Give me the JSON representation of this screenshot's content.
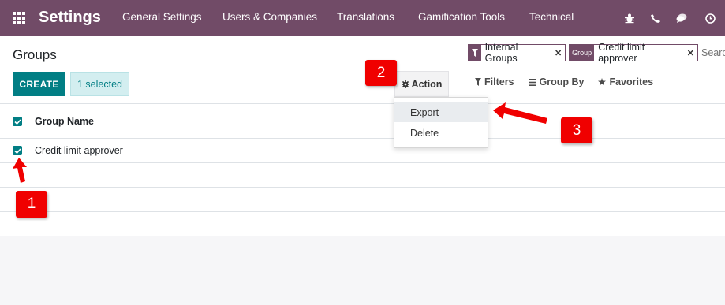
{
  "navbar": {
    "app_title": "Settings",
    "menus": [
      "General Settings",
      "Users & Companies",
      "Translations",
      "Gamification Tools",
      "Technical"
    ],
    "icons": [
      "bug-icon",
      "phone-icon",
      "chat-icon",
      "clock-icon"
    ]
  },
  "control_panel": {
    "title": "Groups",
    "create_label": "CREATE",
    "selected_label": "1 selected",
    "action_label": "Action",
    "facets": [
      {
        "label": "",
        "value": "Internal Groups"
      },
      {
        "label": "Group",
        "value": "Credit limit approver"
      }
    ],
    "search_placeholder": "Search...",
    "options": {
      "filters": "Filters",
      "group_by": "Group By",
      "favorites": "Favorites"
    }
  },
  "list": {
    "header": "Group Name",
    "rows": [
      "Credit limit approver",
      "",
      "",
      ""
    ]
  },
  "action_menu": {
    "items": [
      "Export",
      "Delete"
    ],
    "highlighted": "Export"
  },
  "annotations": [
    "1",
    "2",
    "3"
  ],
  "colors": {
    "brand": "#714b67",
    "primary": "#017e84",
    "annotation": "#f00000"
  }
}
